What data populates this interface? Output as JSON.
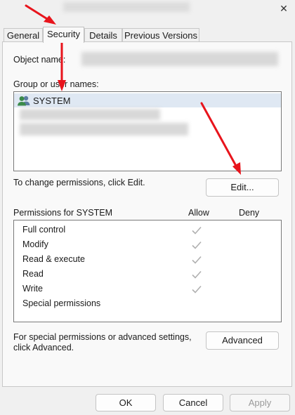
{
  "window": {
    "close_glyph": "✕"
  },
  "tabs": [
    {
      "label": "General"
    },
    {
      "label": "Security"
    },
    {
      "label": "Details"
    },
    {
      "label": "Previous Versions"
    }
  ],
  "object_name_label": "Object name:",
  "groups_label": "Group or user names:",
  "users": [
    {
      "name": "SYSTEM",
      "icon": "users-group-icon"
    }
  ],
  "change_text": "To change permissions, click Edit.",
  "edit_button": "Edit...",
  "permissions": {
    "header": "Permissions for SYSTEM",
    "allow_label": "Allow",
    "deny_label": "Deny",
    "items": [
      {
        "name": "Full control",
        "allow": true
      },
      {
        "name": "Modify",
        "allow": true
      },
      {
        "name": "Read & execute",
        "allow": true
      },
      {
        "name": "Read",
        "allow": true
      },
      {
        "name": "Write",
        "allow": true
      },
      {
        "name": "Special permissions",
        "allow": false
      }
    ]
  },
  "advanced_text_line1": "For special permissions or advanced settings,",
  "advanced_text_line2": "click Advanced.",
  "advanced_button": "Advanced",
  "footer": {
    "ok": "OK",
    "cancel": "Cancel",
    "apply": "Apply"
  },
  "colors": {
    "annotation_arrow": "#e8141c",
    "check_disabled": "#b0b0b0"
  }
}
